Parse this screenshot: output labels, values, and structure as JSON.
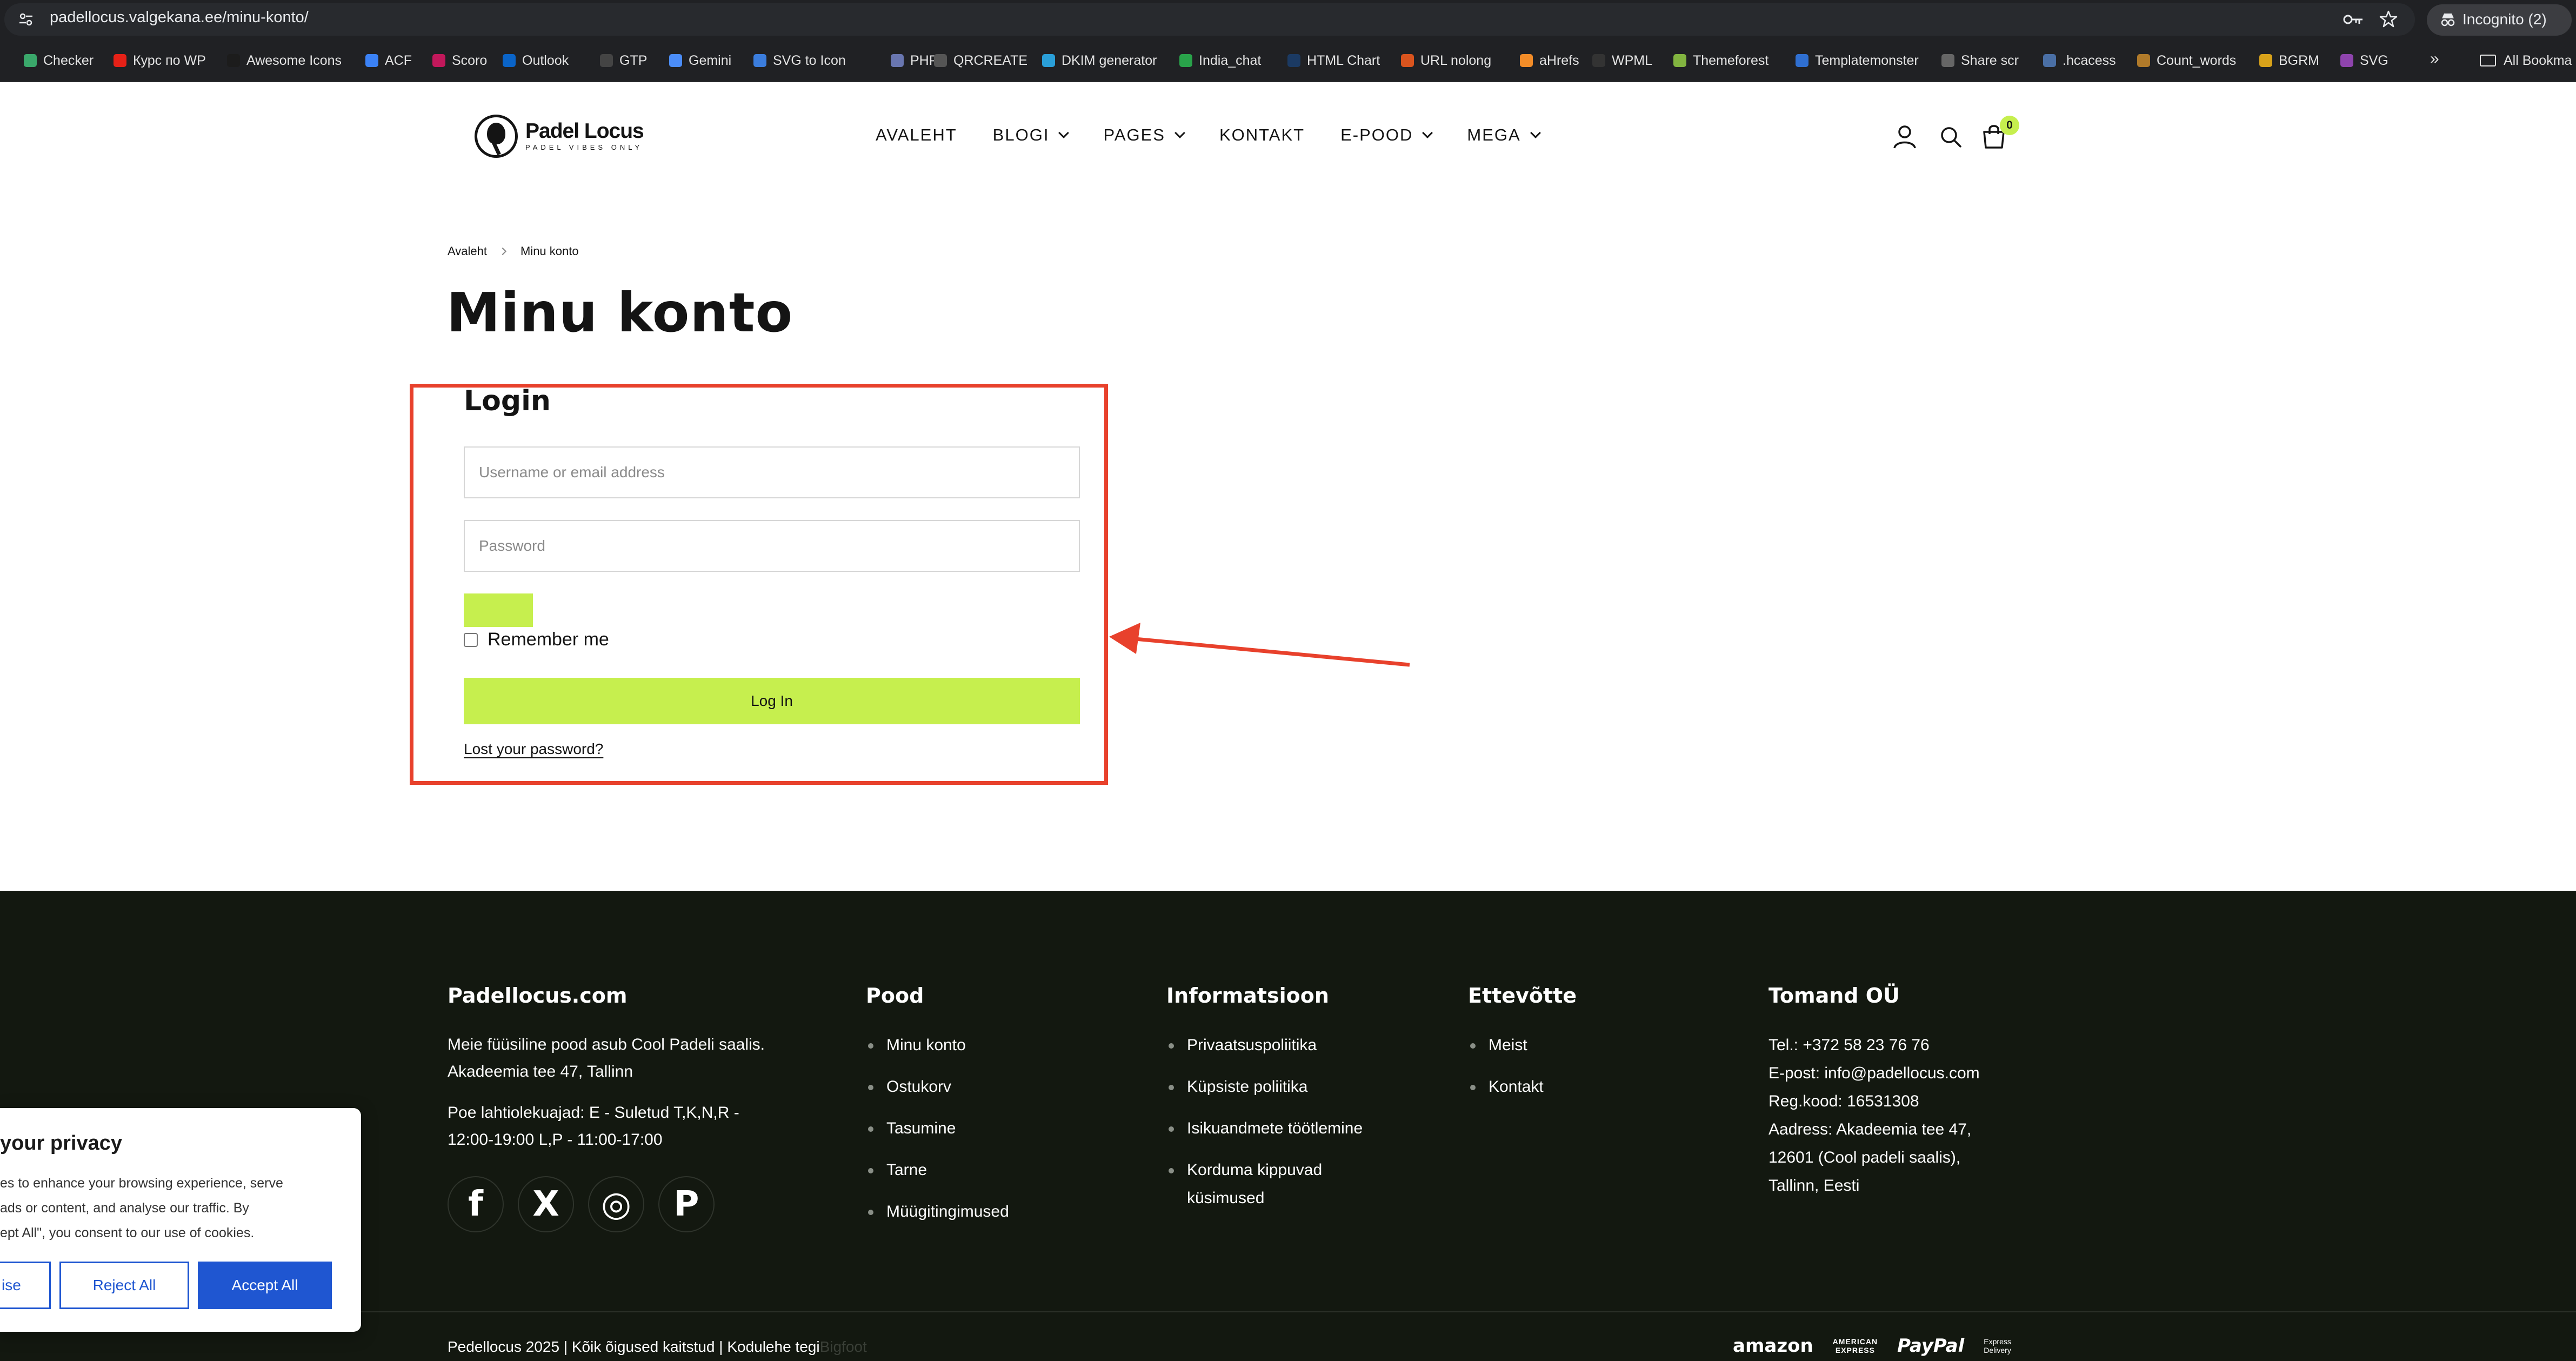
{
  "browser": {
    "url_host": "padellocus.valgekana.ee",
    "url_path": "/minu-konto/",
    "incognito_label": "Incognito (2)",
    "bookmarks": [
      {
        "label": "Checker",
        "color": "#3aa86b"
      },
      {
        "label": "Курс по WP",
        "color": "#e62117"
      },
      {
        "label": "Awesome Icons",
        "color": "#1c1c1c"
      },
      {
        "label": "ACF",
        "color": "#3b82f6"
      },
      {
        "label": "Scoro",
        "color": "#c2185b"
      },
      {
        "label": "Outlook",
        "color": "#0a64c8"
      },
      {
        "label": "GTP",
        "color": "#444444"
      },
      {
        "label": "Gemini",
        "color": "#4b8df8"
      },
      {
        "label": "SVG to Icon",
        "color": "#3b7ddd"
      },
      {
        "label": "PHP",
        "color": "#6976b0"
      },
      {
        "label": "QRCREATE",
        "color": "#555555"
      },
      {
        "label": "DKIM generator",
        "color": "#2a9fd8"
      },
      {
        "label": "India_chat",
        "color": "#29a34a"
      },
      {
        "label": "HTML Chart",
        "color": "#1b3a63"
      },
      {
        "label": "URL nolong",
        "color": "#d9541e"
      },
      {
        "label": "aHrefs",
        "color": "#f28c28"
      },
      {
        "label": "WPML",
        "color": "#333333"
      },
      {
        "label": "Themeforest",
        "color": "#82b440"
      },
      {
        "label": "Templatemonster",
        "color": "#2f6fd1"
      },
      {
        "label": "Share scr",
        "color": "#666666"
      },
      {
        "label": ".hcacess",
        "color": "#4a6fa5"
      },
      {
        "label": "Count_words",
        "color": "#b07a2a"
      },
      {
        "label": "BGRM",
        "color": "#d8a21a"
      },
      {
        "label": "SVG",
        "color": "#8e44ad"
      }
    ],
    "bookmarks_more": "»",
    "all_bookmarks": "All Bookma"
  },
  "header": {
    "logo_name": "Padel Locus",
    "logo_tagline": "PADEL VIBES ONLY",
    "nav": [
      {
        "label": "AVALEHT",
        "dropdown": false
      },
      {
        "label": "BLOGI",
        "dropdown": true
      },
      {
        "label": "PAGES",
        "dropdown": true
      },
      {
        "label": "KONTAKT",
        "dropdown": false
      },
      {
        "label": "E-POOD",
        "dropdown": true
      },
      {
        "label": "MEGA",
        "dropdown": true
      }
    ],
    "cart_count": "0"
  },
  "breadcrumb": {
    "home": "Avaleht",
    "current": "Minu konto"
  },
  "page_title": "Minu konto",
  "login": {
    "heading": "Login",
    "username_placeholder": "Username or email address",
    "password_placeholder": "Password",
    "remember_label": "Remember me",
    "remember_checked": false,
    "button_label": "Log In",
    "lost_password": "Lost your password?"
  },
  "annotation": {
    "color": "#e8412c"
  },
  "footer": {
    "col1": {
      "heading": "Padellocus.com",
      "lines_a": [
        "Meie füüsiline pood asub Cool Padeli saalis.",
        "Akadeemia tee 47, Tallinn"
      ],
      "lines_b": [
        "Poe lahtiolekuajad: E - Suletud T,K,N,R -",
        "12:00-19:00 L,P - 11:00-17:00"
      ]
    },
    "col2": {
      "heading": "Pood",
      "links": [
        "Minu konto",
        "Ostukorv",
        "Tasumine",
        "Tarne",
        "Müügitingimused"
      ]
    },
    "col3": {
      "heading": "Informatsioon",
      "links": [
        "Privaatsuspoliitika",
        "Küpsiste poliitika",
        "Isikuandmete töötlemine",
        "Korduma kippuvad",
        "küsimused"
      ]
    },
    "col4": {
      "heading": "Ettevõtte",
      "links": [
        "Meist",
        "Kontakt"
      ]
    },
    "col5": {
      "heading": "Tomand OÜ",
      "lines": [
        "Tel.: +372 58 23 76 76",
        "E-post: info@padellocus.com",
        "Reg.kood: 16531308",
        "Aadress: Akadeemia tee 47,",
        "12601 (Cool padeli saalis),",
        "Tallinn, Eesti"
      ]
    },
    "social": [
      {
        "name": "facebook",
        "glyph": "f"
      },
      {
        "name": "x",
        "glyph": "X"
      },
      {
        "name": "instagram",
        "glyph": "◎"
      },
      {
        "name": "pinterest",
        "glyph": "P"
      }
    ],
    "copyright": "Pedellocus 2025 | Kõik õigused kaitstud | Kodulehe tegi",
    "copyright_tail": "Bigfoot",
    "payments": {
      "amazon": "amazon",
      "amex_1": "AMERICAN",
      "amex_2": "EXPRESS",
      "paypal": "PayPal",
      "delivery_1": "Express",
      "delivery_2": "Delivery"
    }
  },
  "cookie": {
    "title": "your privacy",
    "lines": [
      "es to enhance your browsing experience, serve",
      " ads or content, and analyse our traffic. By",
      "ept All\", you consent to our use of cookies."
    ],
    "customise": "ise",
    "reject": "Reject All",
    "accept": "Accept All",
    "accent": "#1f56d1"
  }
}
